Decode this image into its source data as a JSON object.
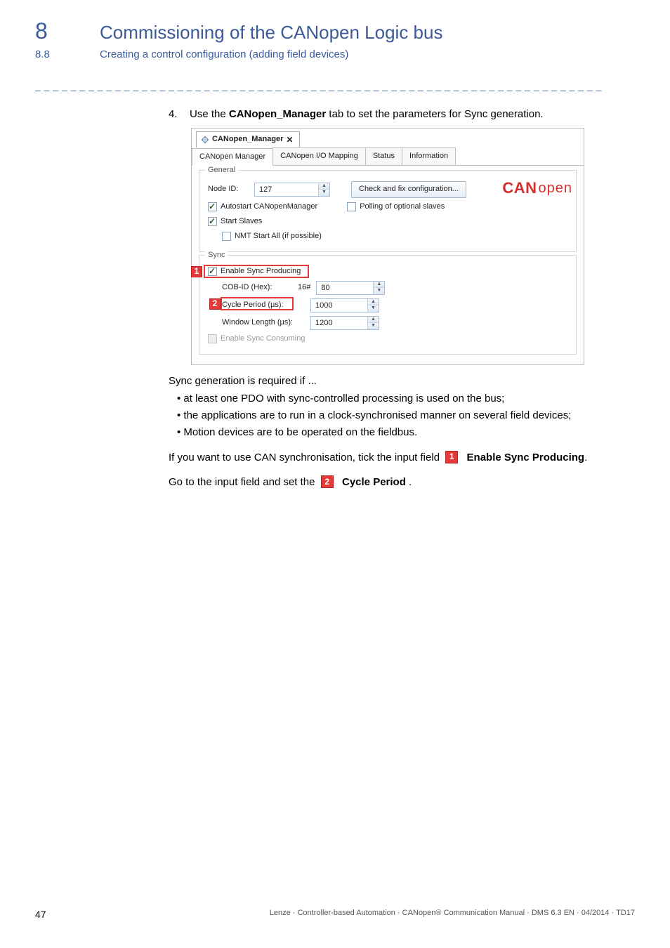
{
  "header": {
    "chapter_num": "8",
    "chapter_title": "Commissioning of the CANopen Logic bus",
    "section_num": "8.8",
    "section_title": "Creating a control configuration (adding field devices)"
  },
  "dashes": "_ _ _ _ _ _ _ _ _ _ _ _ _ _ _ _ _ _ _ _ _ _ _ _ _ _ _ _ _ _ _ _ _ _ _ _ _ _ _ _ _ _ _ _ _ _ _ _ _ _ _ _ _ _ _ _ _ _ _ _ _ _ _ _",
  "step": {
    "num": "4.",
    "pre": "Use the ",
    "bold": "CANopen_Manager",
    "post": " tab to set the parameters for Sync generation."
  },
  "shot": {
    "main_tab": "CANopen_Manager",
    "close": "✕",
    "tabs": [
      "CANopen Manager",
      "CANopen I/O Mapping",
      "Status",
      "Information"
    ],
    "general": {
      "legend": "General",
      "node_id_label": "Node ID:",
      "node_id_value": "127",
      "check_btn": "Check and fix configuration...",
      "autostart": "Autostart CANopenManager",
      "polling": "Polling of optional slaves",
      "start_slaves": "Start Slaves",
      "nmt_start_all": "NMT Start All (if possible)"
    },
    "sync": {
      "legend": "Sync",
      "enable_producing": "Enable Sync Producing",
      "cob_id_label": "COB-ID (Hex):",
      "cob_id_prefix": "16#",
      "cob_id_value": "80",
      "cycle_label": "Cycle Period (µs):",
      "cycle_value": "1000",
      "window_label": "Window Length (µs):",
      "window_value": "1200",
      "enable_consuming": "Enable Sync Consuming"
    },
    "logo": {
      "can": "CAN",
      "open": "open"
    },
    "markers": {
      "m1": "1",
      "m2": "2"
    }
  },
  "after": {
    "intro": "Sync generation is required if ...",
    "bullets": [
      "at least one PDO with sync-controlled processing is used on the bus;",
      "the applications are to run in a clock-synchronised manner on several field devices;",
      "Motion devices are to be operated on the fieldbus."
    ],
    "p1_pre": "If you want to use CAN synchronisation, tick the input field ",
    "p1_bold": "Enable Sync Producing",
    "p1_post": ".",
    "p2_pre": "Go to the input field  and set the ",
    "p2_bold": "Cycle Period",
    "p2_post": " ."
  },
  "footer": {
    "page": "47",
    "line": "Lenze · Controller-based Automation · CANopen® Communication Manual · DMS 6.3 EN · 04/2014 · TD17"
  }
}
